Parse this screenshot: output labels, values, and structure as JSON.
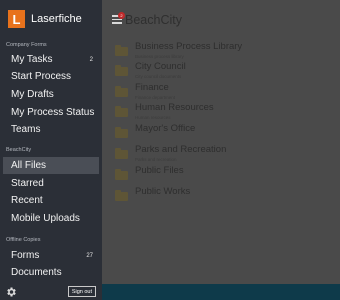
{
  "brand": {
    "logo_letter": "L",
    "name": "Laserfiche",
    "accent": "#e8721c"
  },
  "sections": {
    "company_forms": "Company Forms",
    "beachcity": "BeachCity",
    "offline": "Offline Copies"
  },
  "nav": {
    "my_tasks": {
      "label": "My Tasks",
      "badge": "2"
    },
    "start_process": {
      "label": "Start Process"
    },
    "my_drafts": {
      "label": "My Drafts"
    },
    "my_process_status": {
      "label": "My Process Status"
    },
    "teams": {
      "label": "Teams"
    },
    "all_files": {
      "label": "All Files",
      "active": true
    },
    "starred": {
      "label": "Starred"
    },
    "recent": {
      "label": "Recent"
    },
    "mobile_uploads": {
      "label": "Mobile Uploads"
    },
    "forms": {
      "label": "Forms",
      "badge": "27"
    },
    "documents": {
      "label": "Documents"
    }
  },
  "footer": {
    "sign_out": "Sign out"
  },
  "header": {
    "title": "BeachCity",
    "notification_count": "2"
  },
  "folders": [
    {
      "name": "Business Process Library",
      "sub": "Business process library"
    },
    {
      "name": "City Council",
      "sub": "City council documents"
    },
    {
      "name": "Finance",
      "sub": "Finance department"
    },
    {
      "name": "Human Resources",
      "sub": "Human resources"
    },
    {
      "name": "Mayor's Office",
      "sub": ""
    },
    {
      "name": "Parks and Recreation",
      "sub": "Parks and recreation"
    },
    {
      "name": "Public Files",
      "sub": ""
    },
    {
      "name": "Public Works",
      "sub": ""
    }
  ]
}
